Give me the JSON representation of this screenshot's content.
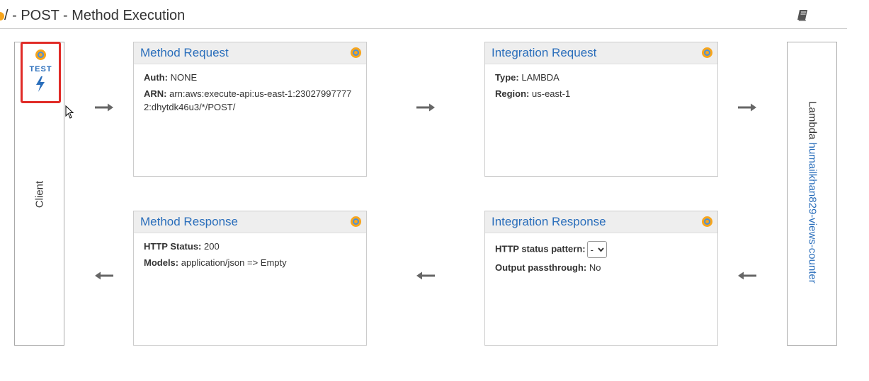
{
  "header": {
    "title": "/ - POST - Method Execution",
    "icon": "book-icon"
  },
  "client": {
    "label": "Client",
    "test_button": {
      "label": "TEST",
      "icon": "lightning-bolt-icon"
    }
  },
  "method_request": {
    "title": "Method Request",
    "auth_label": "Auth:",
    "auth_value": "NONE",
    "arn_label": "ARN:",
    "arn_value": "arn:aws:execute-api:us-east-1:230279977772:dhytdk46u3/*/POST/"
  },
  "integration_request": {
    "title": "Integration Request",
    "type_label": "Type:",
    "type_value": "LAMBDA",
    "region_label": "Region:",
    "region_value": "us-east-1"
  },
  "method_response": {
    "title": "Method Response",
    "status_label": "HTTP Status:",
    "status_value": "200",
    "models_label": "Models:",
    "models_value": "application/json => Empty"
  },
  "integration_response": {
    "title": "Integration Response",
    "pattern_label": "HTTP status pattern:",
    "pattern_value": "-",
    "passthrough_label": "Output passthrough:",
    "passthrough_value": "No"
  },
  "lambda": {
    "prefix": "Lambda",
    "function_name": "humailkhan829-views-counter"
  },
  "colors": {
    "link": "#2a6ebb",
    "accent_orange": "#f7a51c",
    "highlight_red": "#e02b27",
    "arrow_gray": "#666666"
  }
}
